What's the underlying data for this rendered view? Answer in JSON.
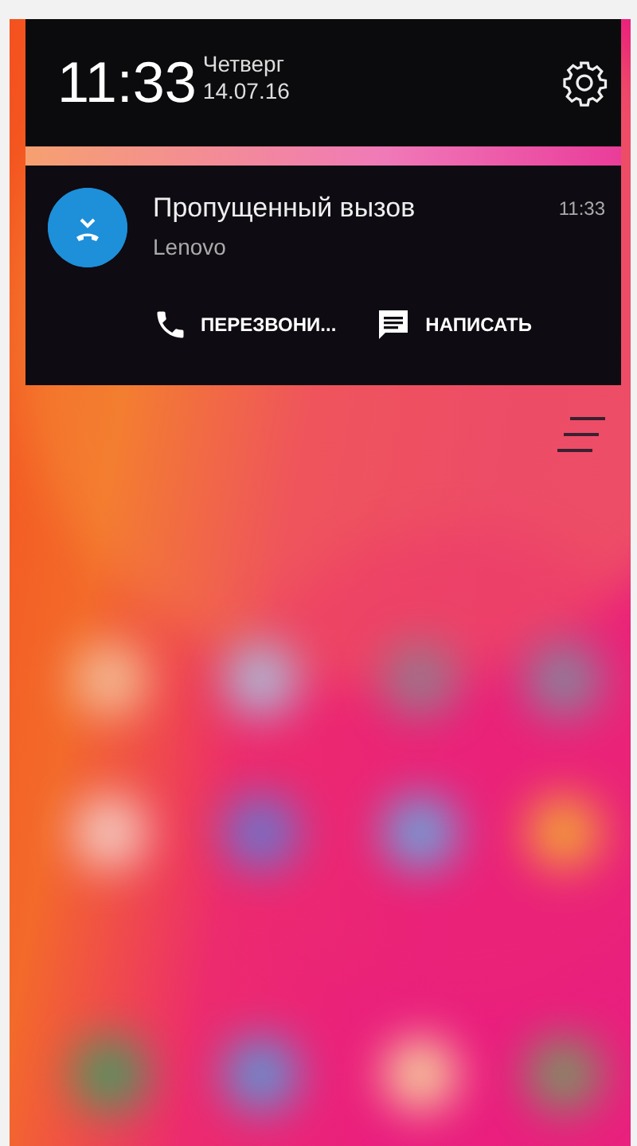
{
  "header": {
    "time": "11:33",
    "day": "Четверг",
    "date": "14.07.16"
  },
  "notification": {
    "title": "Пропущенный вызов",
    "source": "Lenovo",
    "time": "11:33",
    "actions": [
      {
        "kind": "call",
        "label": "ПЕРЕЗВОНИ..."
      },
      {
        "kind": "message",
        "label": "НАПИСАТЬ"
      }
    ]
  }
}
